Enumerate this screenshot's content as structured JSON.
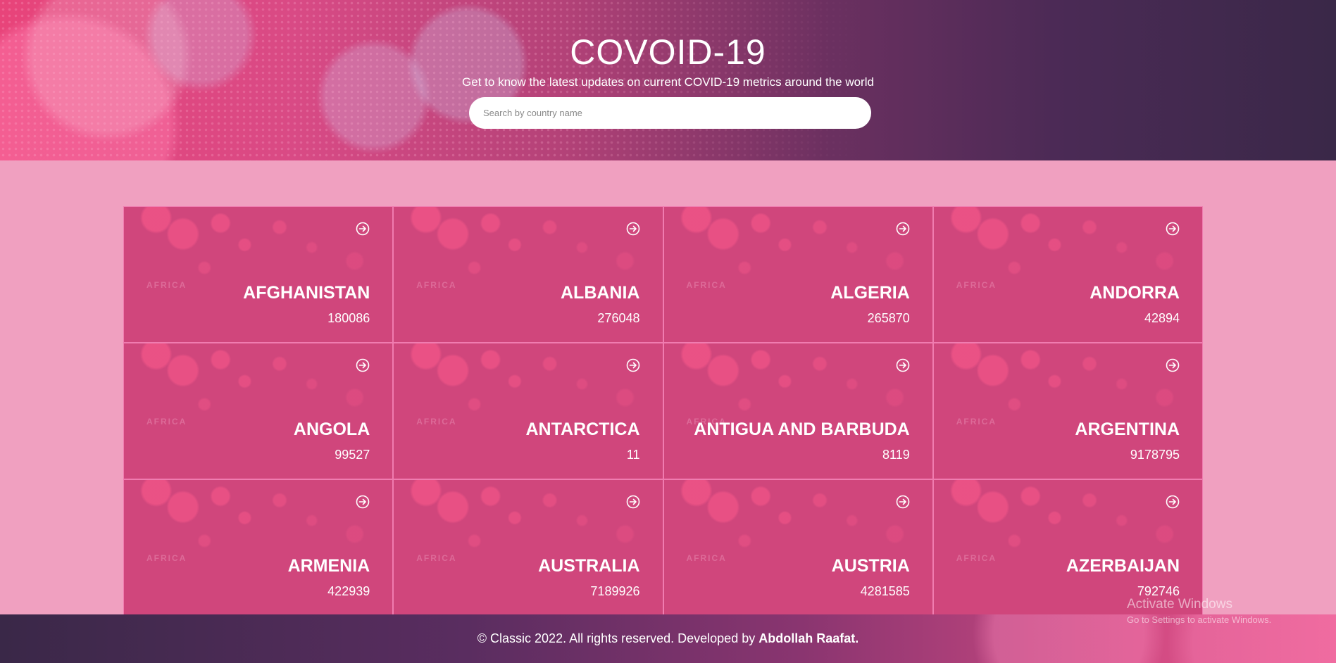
{
  "hero": {
    "title": "COVOID-19",
    "subtitle": "Get to know the latest updates on current COVID-19 metrics around the world",
    "search_placeholder": "Search by country name"
  },
  "map_label": "AFRICA",
  "countries": [
    {
      "name": "AFGHANISTAN",
      "count": "180086"
    },
    {
      "name": "ALBANIA",
      "count": "276048"
    },
    {
      "name": "ALGERIA",
      "count": "265870"
    },
    {
      "name": "ANDORRA",
      "count": "42894"
    },
    {
      "name": "ANGOLA",
      "count": "99527"
    },
    {
      "name": "ANTARCTICA",
      "count": "11"
    },
    {
      "name": "ANTIGUA AND BARBUDA",
      "count": "8119"
    },
    {
      "name": "ARGENTINA",
      "count": "9178795"
    },
    {
      "name": "ARMENIA",
      "count": "422939"
    },
    {
      "name": "AUSTRALIA",
      "count": "7189926"
    },
    {
      "name": "AUSTRIA",
      "count": "4281585"
    },
    {
      "name": "AZERBAIJAN",
      "count": "792746"
    }
  ],
  "footer": {
    "text": "© Classic 2022. All rights reserved. Developed by",
    "author": "Abdollah Raafat."
  },
  "watermark": {
    "line1": "Activate Windows",
    "line2": "Go to Settings to activate Windows."
  },
  "colors": {
    "page_bg": "#f0a0c0",
    "card_bg": "#d0467c",
    "card_border": "#f07cb0"
  },
  "icons": {
    "card_link": "arrow-circle-right-icon"
  }
}
